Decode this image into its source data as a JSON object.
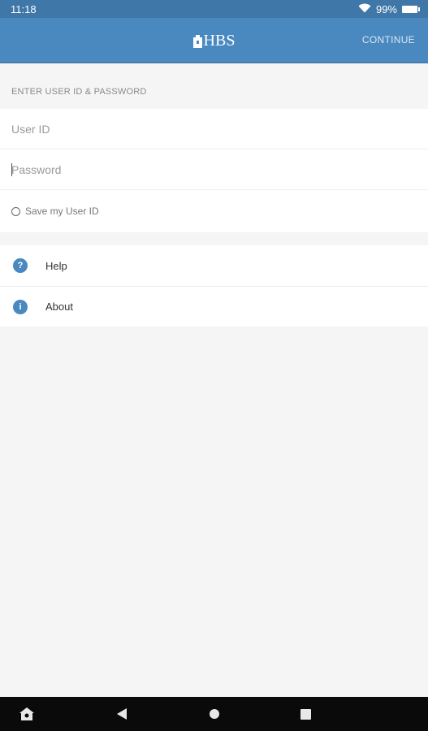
{
  "status_bar": {
    "time": "11:18",
    "battery": "99%"
  },
  "app_bar": {
    "logo_text": "HBS",
    "continue_label": "CONTINUE"
  },
  "login": {
    "section_header": "ENTER USER ID & PASSWORD",
    "user_id_placeholder": "User ID",
    "password_placeholder": "Password",
    "save_user_id_label": "Save my User ID"
  },
  "menu": {
    "items": [
      {
        "label": "Help",
        "icon": "help-icon",
        "glyph": "?"
      },
      {
        "label": "About",
        "icon": "info-icon",
        "glyph": "i"
      }
    ]
  },
  "colors": {
    "status_bar": "#3f77a8",
    "app_bar": "#4a88c0",
    "background": "#f5f5f5",
    "icon_accent": "#4a88c0"
  }
}
